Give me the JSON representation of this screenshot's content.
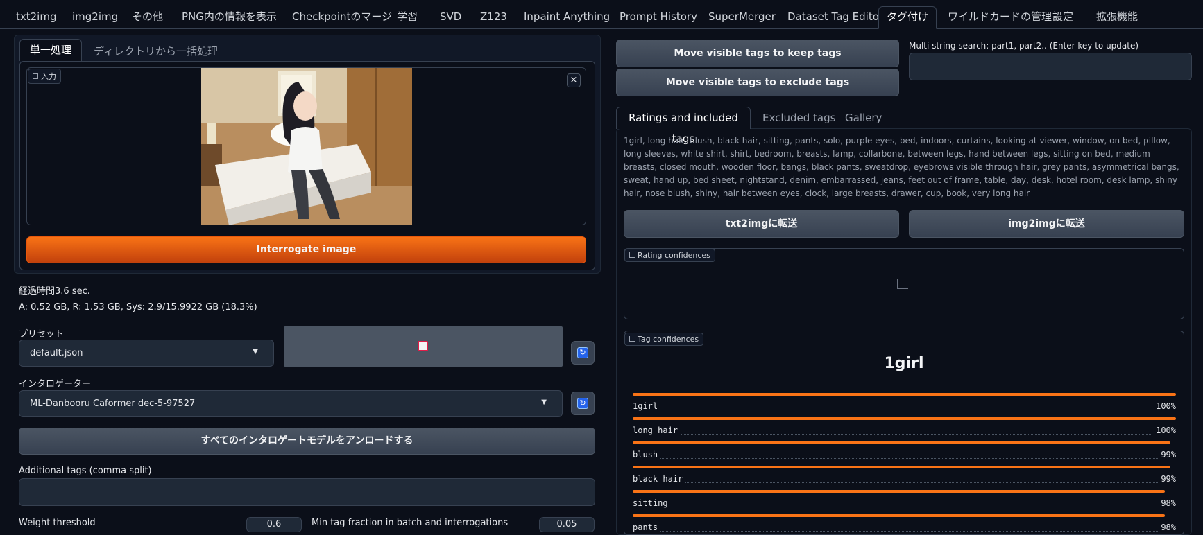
{
  "top_tabs": [
    "txt2img",
    "img2img",
    "その他",
    "PNG内の情報を表示",
    "Checkpointのマージ",
    "学習",
    "SVD",
    "Z123",
    "Inpaint Anything",
    "Prompt History",
    "SuperMerger",
    "Dataset Tag Editor",
    "タグ付け",
    "ワイルドカードの管理",
    "設定",
    "拡張機能"
  ],
  "active_tab": "タグ付け",
  "left": {
    "subtabs": [
      "単一処理",
      "ディレクトリから一括処理"
    ],
    "image_label": "入力",
    "close_glyph": "×",
    "interrogate_button": "Interrogate image",
    "elapsed": "経過時間3.6 sec.",
    "memory": "A: 0.52 GB, R: 1.53 GB, Sys: 2.9/15.9922 GB (18.3%)",
    "preset_label": "プリセット",
    "preset_value": "default.json",
    "interrogator_label": "インタロゲーター",
    "interrogator_value": "ML-Danbooru Caformer dec-5-97527",
    "unload_button": "すべてのインタロゲートモデルをアンロードする",
    "additional_tags_label": "Additional tags (comma split)",
    "additional_tags_value": "",
    "weight_threshold_label": "Weight threshold",
    "weight_threshold_value": "0.6",
    "min_tag_label": "Min tag fraction in batch and interrogations",
    "min_tag_value": "0.05"
  },
  "right": {
    "keep_button": "Move visible tags to keep tags",
    "exclude_button": "Move visible tags to exclude tags",
    "search_label": "Multi string search: part1, part2.. (Enter key to update)",
    "search_value": "",
    "subtabs": [
      "Ratings and included tags",
      "Excluded tags",
      "Gallery"
    ],
    "tags_text": "1girl, long hair, blush, black hair, sitting, pants, solo, purple eyes, bed, indoors, curtains, looking at viewer, window, on bed, pillow, long sleeves, white shirt, shirt, bedroom, breasts, lamp, collarbone, between legs, hand between legs, sitting on bed, medium breasts, closed mouth, wooden floor, bangs, black pants, sweatdrop, eyebrows visible through hair, grey pants, asymmetrical bangs, sweat, hand up, bed sheet, nightstand, denim, embarrassed, jeans, feet out of frame, table, day, desk, hotel room, desk lamp, shiny hair, nose blush, shiny, hair between eyes, clock, large breasts, drawer, cup, book, very long hair",
    "send_txt2img": "txt2imgに転送",
    "send_img2img": "img2imgに転送",
    "rating_label": "Rating confidences",
    "tag_conf_label": "Tag confidences",
    "top_tag": "1girl",
    "confidences": [
      {
        "name": "1girl",
        "value": 1.0,
        "pct": "100%"
      },
      {
        "name": "long hair",
        "value": 1.0,
        "pct": "100%"
      },
      {
        "name": "blush",
        "value": 0.99,
        "pct": "99%"
      },
      {
        "name": "black hair",
        "value": 0.99,
        "pct": "99%"
      },
      {
        "name": "sitting",
        "value": 0.98,
        "pct": "98%"
      },
      {
        "name": "pants",
        "value": 0.98,
        "pct": "98%"
      }
    ]
  },
  "icons": {
    "image": "image-icon",
    "close": "close-icon",
    "dropdown": "chevron-down-icon",
    "save": "save-icon",
    "refresh": "refresh-icon",
    "chart": "chart-icon"
  },
  "colors": {
    "background": "#0b0f19",
    "panel": "#111827",
    "accent": "#f97316",
    "border": "#374151"
  }
}
